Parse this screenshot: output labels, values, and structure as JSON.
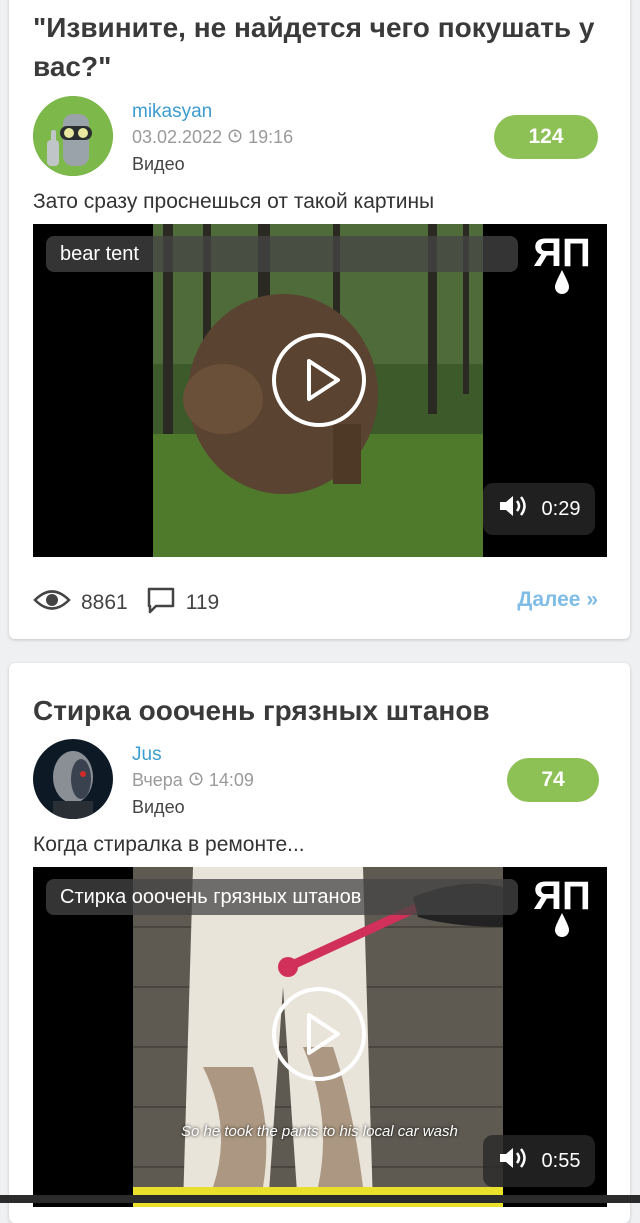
{
  "posts": [
    {
      "title": "\"Извините, не найдется чего покушать у вас?\"",
      "author": "mikasyan",
      "date": "03.02.2022",
      "time": "19:16",
      "kind": "Видео",
      "rating": "124",
      "description": "Зато сразу проснешься от такой картины",
      "video_title": "bear tent",
      "logo_text": "ЯП",
      "duration": "0:29",
      "views": "8861",
      "comments": "119",
      "more_label": "Далее »"
    },
    {
      "title": "Стирка ооочень грязных штанов",
      "author": "Jus",
      "date": "Вчера",
      "time": "14:09",
      "kind": "Видео",
      "rating": "74",
      "description": "Когда стиралка в ремонте...",
      "video_title": "Стирка ооочень грязных штанов",
      "logo_text": "ЯП",
      "subtitle": "So he took the pants to his local car wash",
      "duration": "0:55"
    }
  ],
  "colors": {
    "accent_green": "#8dc055",
    "author_blue": "#3b9ccf",
    "more_blue": "#7fbde6"
  }
}
